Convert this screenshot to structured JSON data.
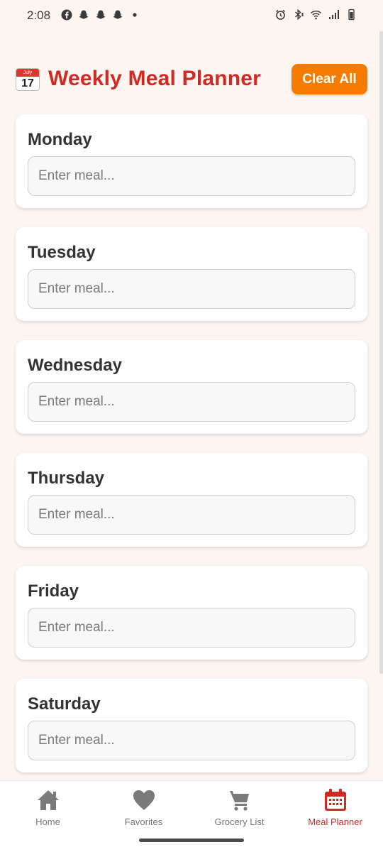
{
  "status_bar": {
    "time": "2:08",
    "notification_icons": [
      "facebook-icon",
      "snapchat-icon",
      "snapchat-icon",
      "snapchat-icon",
      "dot-icon"
    ],
    "system_icons": [
      "alarm-icon",
      "bluetooth-icon",
      "wifi-icon",
      "signal-icon",
      "battery-icon"
    ]
  },
  "header": {
    "emoji_month": "July",
    "emoji_day": "17",
    "title": "Weekly Meal Planner",
    "clear_button": "Clear All"
  },
  "days": [
    {
      "name": "Monday",
      "placeholder": "Enter meal...",
      "value": ""
    },
    {
      "name": "Tuesday",
      "placeholder": "Enter meal...",
      "value": ""
    },
    {
      "name": "Wednesday",
      "placeholder": "Enter meal...",
      "value": ""
    },
    {
      "name": "Thursday",
      "placeholder": "Enter meal...",
      "value": ""
    },
    {
      "name": "Friday",
      "placeholder": "Enter meal...",
      "value": ""
    },
    {
      "name": "Saturday",
      "placeholder": "Enter meal...",
      "value": ""
    }
  ],
  "nav": {
    "items": [
      {
        "label": "Home",
        "icon": "home-icon",
        "active": false
      },
      {
        "label": "Favorites",
        "icon": "heart-icon",
        "active": false
      },
      {
        "label": "Grocery List",
        "icon": "cart-icon",
        "active": false
      },
      {
        "label": "Meal Planner",
        "icon": "calendar-icon",
        "active": true
      }
    ]
  },
  "colors": {
    "background": "#fdf5ef",
    "title": "#d12a24",
    "accent_button": "#f57c00",
    "nav_inactive": "#757575",
    "nav_active": "#d12a24"
  }
}
